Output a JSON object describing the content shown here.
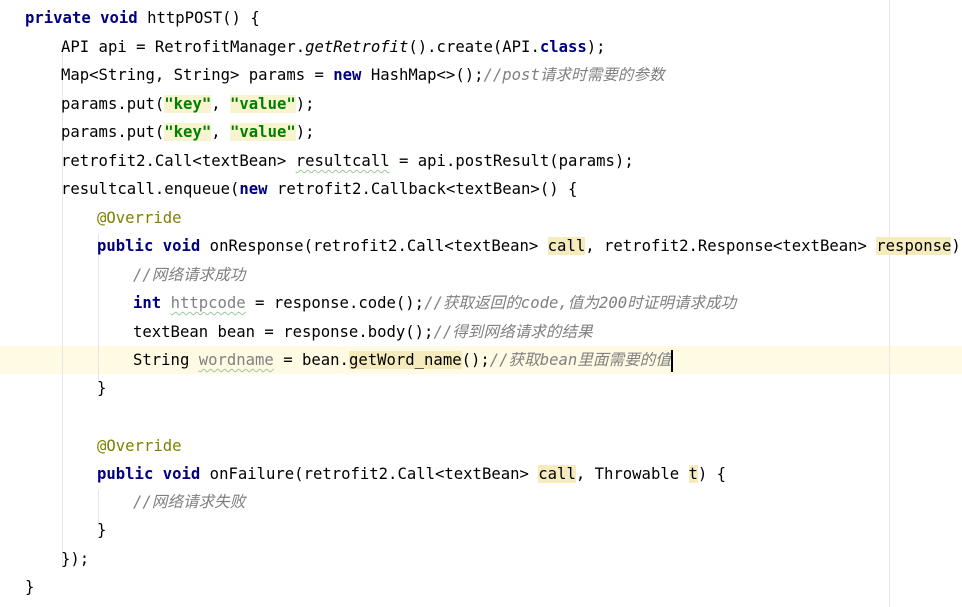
{
  "editor": {
    "lines": [
      {
        "p": [
          "private",
          " ",
          "void",
          " ",
          "httpPOST",
          "() {"
        ]
      },
      {
        "p": [
          "API api = RetrofitManager.",
          "getRetrofit",
          "().create(API.",
          "class",
          ");"
        ]
      },
      {
        "p": [
          "Map<String, String> params = ",
          "new",
          " HashMap<>();",
          "//post请求时需要的参数"
        ]
      },
      {
        "p": [
          "params.put(",
          "\"key\"",
          ", ",
          "\"value\"",
          ");"
        ]
      },
      {
        "p": [
          "params.put(",
          "\"key\"",
          ", ",
          "\"value\"",
          ");"
        ]
      },
      {
        "p": [
          "retrofit2.Call<textBean> ",
          "resultcall",
          " = api.postResult(params);"
        ]
      },
      {
        "p": [
          "resultcall.enqueue(",
          "new",
          " retrofit2.Callback<textBean>() {"
        ]
      },
      {
        "p": [
          "@Override"
        ]
      },
      {
        "p": [
          "public",
          " ",
          "void",
          " onResponse(retrofit2.Call<textBean> ",
          "call",
          ", retrofit2.Response<textBean> ",
          "response",
          ") {"
        ]
      },
      {
        "p": [
          "//网络请求成功"
        ]
      },
      {
        "p": [
          "int",
          " ",
          "httpcode",
          " = response.code();",
          "//获取返回的code,值为200时证明请求成功"
        ]
      },
      {
        "p": [
          "textBean bean = response.body();",
          "//得到网络请求的结果"
        ]
      },
      {
        "p": [
          "String ",
          "wordname",
          " = bean.",
          "getWord_name",
          "();",
          "//获取bean里面需要的值"
        ]
      },
      {
        "p": [
          "}"
        ]
      },
      {
        "p": [
          ""
        ]
      },
      {
        "p": [
          "@Override"
        ]
      },
      {
        "p": [
          "public",
          " ",
          "void",
          " onFailure(retrofit2.Call<textBean> ",
          "call",
          ", Throwable ",
          "t",
          ") {"
        ]
      },
      {
        "p": [
          "//网络请求失败"
        ]
      },
      {
        "p": [
          "}"
        ]
      },
      {
        "p": [
          "});"
        ]
      },
      {
        "p": [
          "}"
        ]
      }
    ]
  }
}
